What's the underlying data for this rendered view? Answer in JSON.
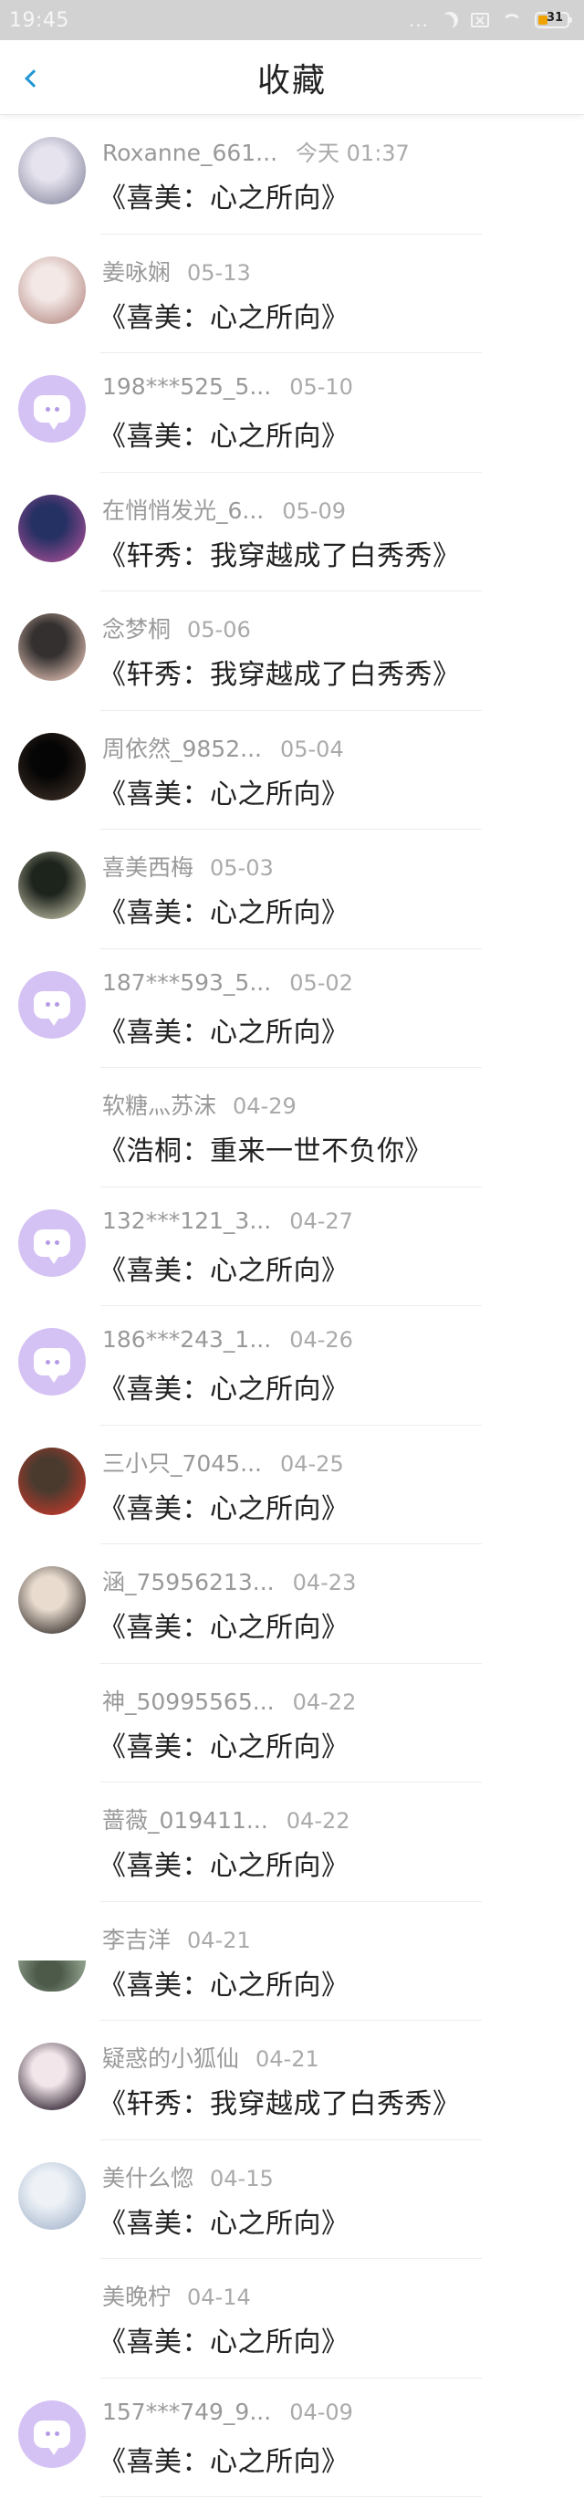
{
  "status_bar": {
    "time": "19:45",
    "dots": "...",
    "battery": "31"
  },
  "nav": {
    "title": "收藏"
  },
  "items": [
    {
      "name": "Roxanne_661...",
      "time": "今天 01:37",
      "title": "《喜美：心之所向》",
      "avatar": "photo",
      "avatar_colors": [
        "#e6e3ee",
        "#8e8fa6"
      ]
    },
    {
      "name": "姜咏娴",
      "time": "05-13",
      "title": "《喜美：心之所向》",
      "avatar": "photo",
      "avatar_colors": [
        "#f3e8e6",
        "#b9908a"
      ]
    },
    {
      "name": "198***525_5...",
      "time": "05-10",
      "title": "《喜美：心之所向》",
      "avatar": "default"
    },
    {
      "name": "在悄悄发光_6...",
      "time": "05-09",
      "title": "《轩秀：我穿越成了白秀秀》",
      "avatar": "photo",
      "avatar_colors": [
        "#253063",
        "#a04d93"
      ]
    },
    {
      "name": "念梦桐",
      "time": "05-06",
      "title": "《轩秀：我穿越成了白秀秀》",
      "avatar": "photo",
      "avatar_colors": [
        "#33302f",
        "#dcbcb0"
      ]
    },
    {
      "name": "周依然_9852...",
      "time": "05-04",
      "title": "《喜美：心之所向》",
      "avatar": "photo",
      "avatar_colors": [
        "#050505",
        "#3b2d25"
      ]
    },
    {
      "name": "喜美西梅",
      "time": "05-03",
      "title": "《喜美：心之所向》",
      "avatar": "photo",
      "avatar_colors": [
        "#1d241c",
        "#b9b69f"
      ]
    },
    {
      "name": "187***593_5...",
      "time": "05-02",
      "title": "《喜美：心之所向》",
      "avatar": "default"
    },
    {
      "name": "软糖灬苏沫",
      "time": "04-29",
      "title": "《浩桐：重来一世不负你》",
      "avatar": "none"
    },
    {
      "name": "132***121_3...",
      "time": "04-27",
      "title": "《喜美：心之所向》",
      "avatar": "default"
    },
    {
      "name": "186***243_1...",
      "time": "04-26",
      "title": "《喜美：心之所向》",
      "avatar": "default"
    },
    {
      "name": "三小只_7045...",
      "time": "04-25",
      "title": "《喜美：心之所向》",
      "avatar": "photo",
      "avatar_colors": [
        "#4a3a2e",
        "#c0392b"
      ]
    },
    {
      "name": "涵_75956213...",
      "time": "04-23",
      "title": "《喜美：心之所向》",
      "avatar": "photo",
      "avatar_colors": [
        "#e9dccf",
        "#3b3431"
      ]
    },
    {
      "name": "神_50995565...",
      "time": "04-22",
      "title": "《喜美：心之所向》",
      "avatar": "none"
    },
    {
      "name": "蔷薇_019411...",
      "time": "04-22",
      "title": "《喜美：心之所向》",
      "avatar": "none"
    },
    {
      "name": "李吉洋",
      "time": "04-21",
      "title": "《喜美：心之所向》",
      "avatar": "photo-partial",
      "avatar_colors": [
        "#4d5a4a",
        "#8a9c87"
      ]
    },
    {
      "name": "疑惑的小狐仙",
      "time": "04-21",
      "title": "《轩秀：我穿越成了白秀秀》",
      "avatar": "photo",
      "avatar_colors": [
        "#f2e6ea",
        "#2a1d2c"
      ]
    },
    {
      "name": "美什么惚",
      "time": "04-15",
      "title": "《喜美：心之所向》",
      "avatar": "photo",
      "avatar_colors": [
        "#eef2f7",
        "#a9b9cf"
      ]
    },
    {
      "name": "美晚柠",
      "time": "04-14",
      "title": "《喜美：心之所向》",
      "avatar": "none"
    },
    {
      "name": "157***749_9...",
      "time": "04-09",
      "title": "《喜美：心之所向》",
      "avatar": "default"
    },
    {
      "name": "",
      "time": "",
      "title": "",
      "avatar": "none"
    }
  ]
}
